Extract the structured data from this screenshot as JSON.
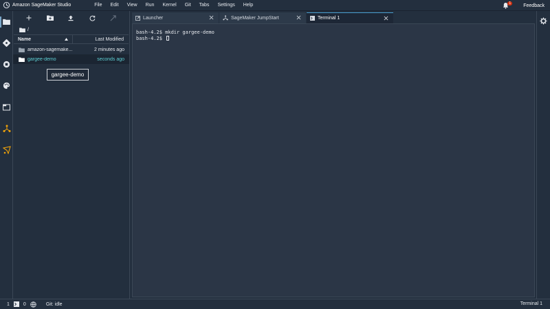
{
  "app": {
    "title": "Amazon SageMaker Studio"
  },
  "menu": [
    "File",
    "Edit",
    "View",
    "Run",
    "Kernel",
    "Git",
    "Tabs",
    "Settings",
    "Help"
  ],
  "topright": {
    "notifications": "1",
    "feedback": "Feedback"
  },
  "file_browser": {
    "path": "/",
    "columns": {
      "name": "Name",
      "modified": "Last Modified"
    },
    "rows": [
      {
        "name": "amazon-sagemake...",
        "modified": "2 minutes ago",
        "selected": false
      },
      {
        "name": "gargee-demo",
        "modified": "seconds ago",
        "selected": true
      }
    ],
    "tooltip": "gargee-demo"
  },
  "tabs": [
    {
      "label": "Launcher",
      "icon": "launcher-icon",
      "active": false
    },
    {
      "label": "SageMaker JumpStart",
      "icon": "jumpstart-icon",
      "active": false
    },
    {
      "label": "Terminal 1",
      "icon": "terminal-icon",
      "active": true
    }
  ],
  "terminal": {
    "lines": [
      "bash-4.2$ mkdir gargee-demo",
      "bash-4.2$ "
    ]
  },
  "statusbar": {
    "count1": "1",
    "count2": "0",
    "git": "Git: idle",
    "right": "Terminal 1"
  },
  "colors": {
    "background": "#232f3e",
    "terminal_bg": "#2b3646",
    "accent": "#5ecfd4",
    "active_tab_border": "#4a9fd1",
    "badge": "#d13212",
    "orange_icon": "#f0a30a"
  }
}
